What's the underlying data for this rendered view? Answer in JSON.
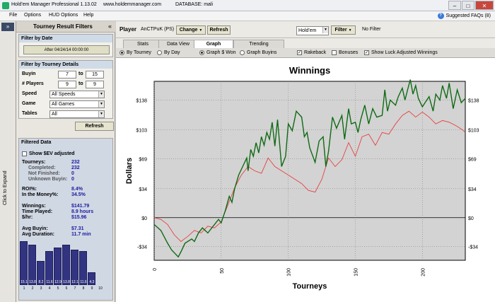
{
  "window": {
    "title": "Hold'em Manager Professional 1.13.02",
    "site": "www.holdemmanager.com",
    "db": "DATABASE: mali"
  },
  "menu": {
    "items": [
      "File",
      "Options",
      "HUD Options",
      "Help"
    ],
    "faq": "Suggested FAQs (8)"
  },
  "side": {
    "expand": "Click to Expand",
    "chevron": "»"
  },
  "filters": {
    "title": "Tourney Result Filters",
    "collapse": "«",
    "by_date": {
      "header": "Filter by Date",
      "button": "After 04/24/14 00:00:00"
    },
    "details": {
      "header": "Filter by Tourney Details",
      "buyin": {
        "label": "Buyin",
        "min": "7",
        "to": "to",
        "max": "15"
      },
      "players": {
        "label": "# Players",
        "min": "9",
        "to": "to",
        "max": "9"
      },
      "speed": {
        "label": "Speed",
        "value": "All Speeds"
      },
      "game": {
        "label": "Game",
        "value": "All Games"
      },
      "tables": {
        "label": "Tables",
        "value": "All"
      }
    },
    "refresh": "Refresh"
  },
  "filtered": {
    "header": "Filtered Data",
    "show_ev": "Show $EV adjusted",
    "rows": [
      {
        "label": "Tourneys:",
        "value": "232"
      },
      {
        "label": "Completed:",
        "value": "232"
      },
      {
        "label": "Not Finished:",
        "value": "0"
      },
      {
        "label": "Unknown Buyin:",
        "value": "0"
      },
      {
        "label": "ROI%:",
        "value": "8.4%"
      },
      {
        "label": "In the Money%:",
        "value": "34.5%"
      },
      {
        "label": "Winnings:",
        "value": "$141.79"
      },
      {
        "label": "Time Played:",
        "value": "8.9 hours"
      },
      {
        "label": "$/hr:",
        "value": "$15.96"
      },
      {
        "label": "Avg Buyin:",
        "value": "$7.31"
      },
      {
        "label": "Avg Duration:",
        "value": "11.7 min"
      }
    ]
  },
  "histogram": {
    "positions": [
      "1",
      "2",
      "3",
      "4",
      "5",
      "6",
      "7",
      "8",
      "9",
      "10"
    ],
    "percents": [
      15.1,
      13.8,
      8.2,
      11.6,
      12.9,
      13.8,
      12.1,
      11.6,
      4.3,
      0
    ],
    "labels": [
      "15.1",
      "13.8",
      "8.2",
      "11.6",
      "12.9",
      "13.8",
      "12.1",
      "11.6",
      "4.3",
      ""
    ]
  },
  "toolbar": {
    "player_label": "Player",
    "player": "AnCTPuK (PS)",
    "change": "Change",
    "refresh": "Refresh",
    "game": "Hold'em",
    "filter": "Filter",
    "no_filter": "No Filter"
  },
  "tabs": [
    "Stats",
    "Data View",
    "Graph",
    "Trending"
  ],
  "options": {
    "by_tourney": "By Tourney",
    "by_day": "By Day",
    "graph_won": "Graph $ Won",
    "graph_buyins": "Graph Buyins",
    "rakeback": "Rakeback",
    "bonuses": "Bonuses",
    "luck": "Show Luck Adjusted Winnings"
  },
  "colors": {
    "actual": "#0f6a14",
    "luck": "#e84040",
    "plot_bg": "#d3d3d3",
    "histo": "#323482"
  },
  "chart_data": {
    "type": "line",
    "title": "Winnings",
    "xlabel": "Tourneys",
    "ylabel": "Dollars",
    "xlim": [
      0,
      232
    ],
    "ylim": [
      -50,
      160
    ],
    "xticks": [
      0,
      50,
      100,
      150,
      200
    ],
    "yticks": [
      -34,
      0,
      34,
      69,
      103,
      138
    ],
    "ytick_labels": [
      "-$34",
      "$0",
      "$34",
      "$69",
      "$103",
      "$138"
    ],
    "grid": true,
    "series": [
      {
        "x": [
          0,
          5,
          10,
          13,
          18,
          20,
          23,
          28,
          30,
          33,
          36,
          40,
          45,
          48,
          50,
          53,
          56,
          58,
          60,
          63,
          66,
          69,
          70,
          72,
          74,
          76,
          78,
          80,
          82,
          84,
          86,
          88,
          90,
          92,
          95,
          98,
          100,
          103,
          106,
          110,
          112,
          114,
          116,
          120,
          123,
          126,
          128,
          130,
          133,
          136,
          140,
          142,
          145,
          147,
          150,
          152,
          154,
          157,
          160,
          163,
          166,
          170,
          172,
          174,
          176,
          180,
          182,
          185,
          187,
          189,
          191,
          193,
          195,
          197,
          200,
          202,
          205,
          208,
          210,
          213,
          215,
          218,
          220,
          223,
          226,
          229,
          232
        ],
        "y": [
          -8,
          -15,
          -30,
          -38,
          -46,
          -40,
          -30,
          -25,
          -28,
          -18,
          -12,
          -18,
          -8,
          -2,
          -6,
          8,
          25,
          18,
          34,
          50,
          60,
          70,
          55,
          80,
          72,
          88,
          76,
          95,
          85,
          100,
          92,
          112,
          84,
          115,
          60,
          72,
          110,
          102,
          125,
          118,
          95,
          100,
          82,
          65,
          90,
          95,
          60,
          78,
          118,
          105,
          120,
          92,
          128,
          110,
          112,
          100,
          115,
          132,
          110,
          128,
          118,
          120,
          150,
          125,
          138,
          132,
          142,
          152,
          138,
          150,
          162,
          145,
          155,
          140,
          130,
          135,
          142,
          125,
          145,
          138,
          155,
          140,
          158,
          128,
          150,
          135,
          140
        ]
      },
      {
        "x": [
          0,
          5,
          10,
          15,
          20,
          25,
          30,
          35,
          40,
          45,
          50,
          55,
          60,
          65,
          70,
          75,
          80,
          85,
          90,
          95,
          100,
          105,
          110,
          115,
          120,
          125,
          130,
          135,
          140,
          145,
          150,
          155,
          160,
          165,
          170,
          175,
          180,
          185,
          190,
          195,
          200,
          205,
          210,
          215,
          220,
          225,
          230,
          232
        ],
        "y": [
          0,
          -2,
          -8,
          -20,
          -28,
          -22,
          -15,
          -18,
          -10,
          -12,
          -5,
          15,
          35,
          50,
          60,
          55,
          52,
          70,
          60,
          55,
          50,
          45,
          40,
          32,
          30,
          45,
          70,
          60,
          68,
          88,
          72,
          95,
          98,
          85,
          100,
          98,
          110,
          120,
          125,
          118,
          124,
          118,
          110,
          114,
          112,
          108,
          103,
          100
        ]
      }
    ]
  }
}
